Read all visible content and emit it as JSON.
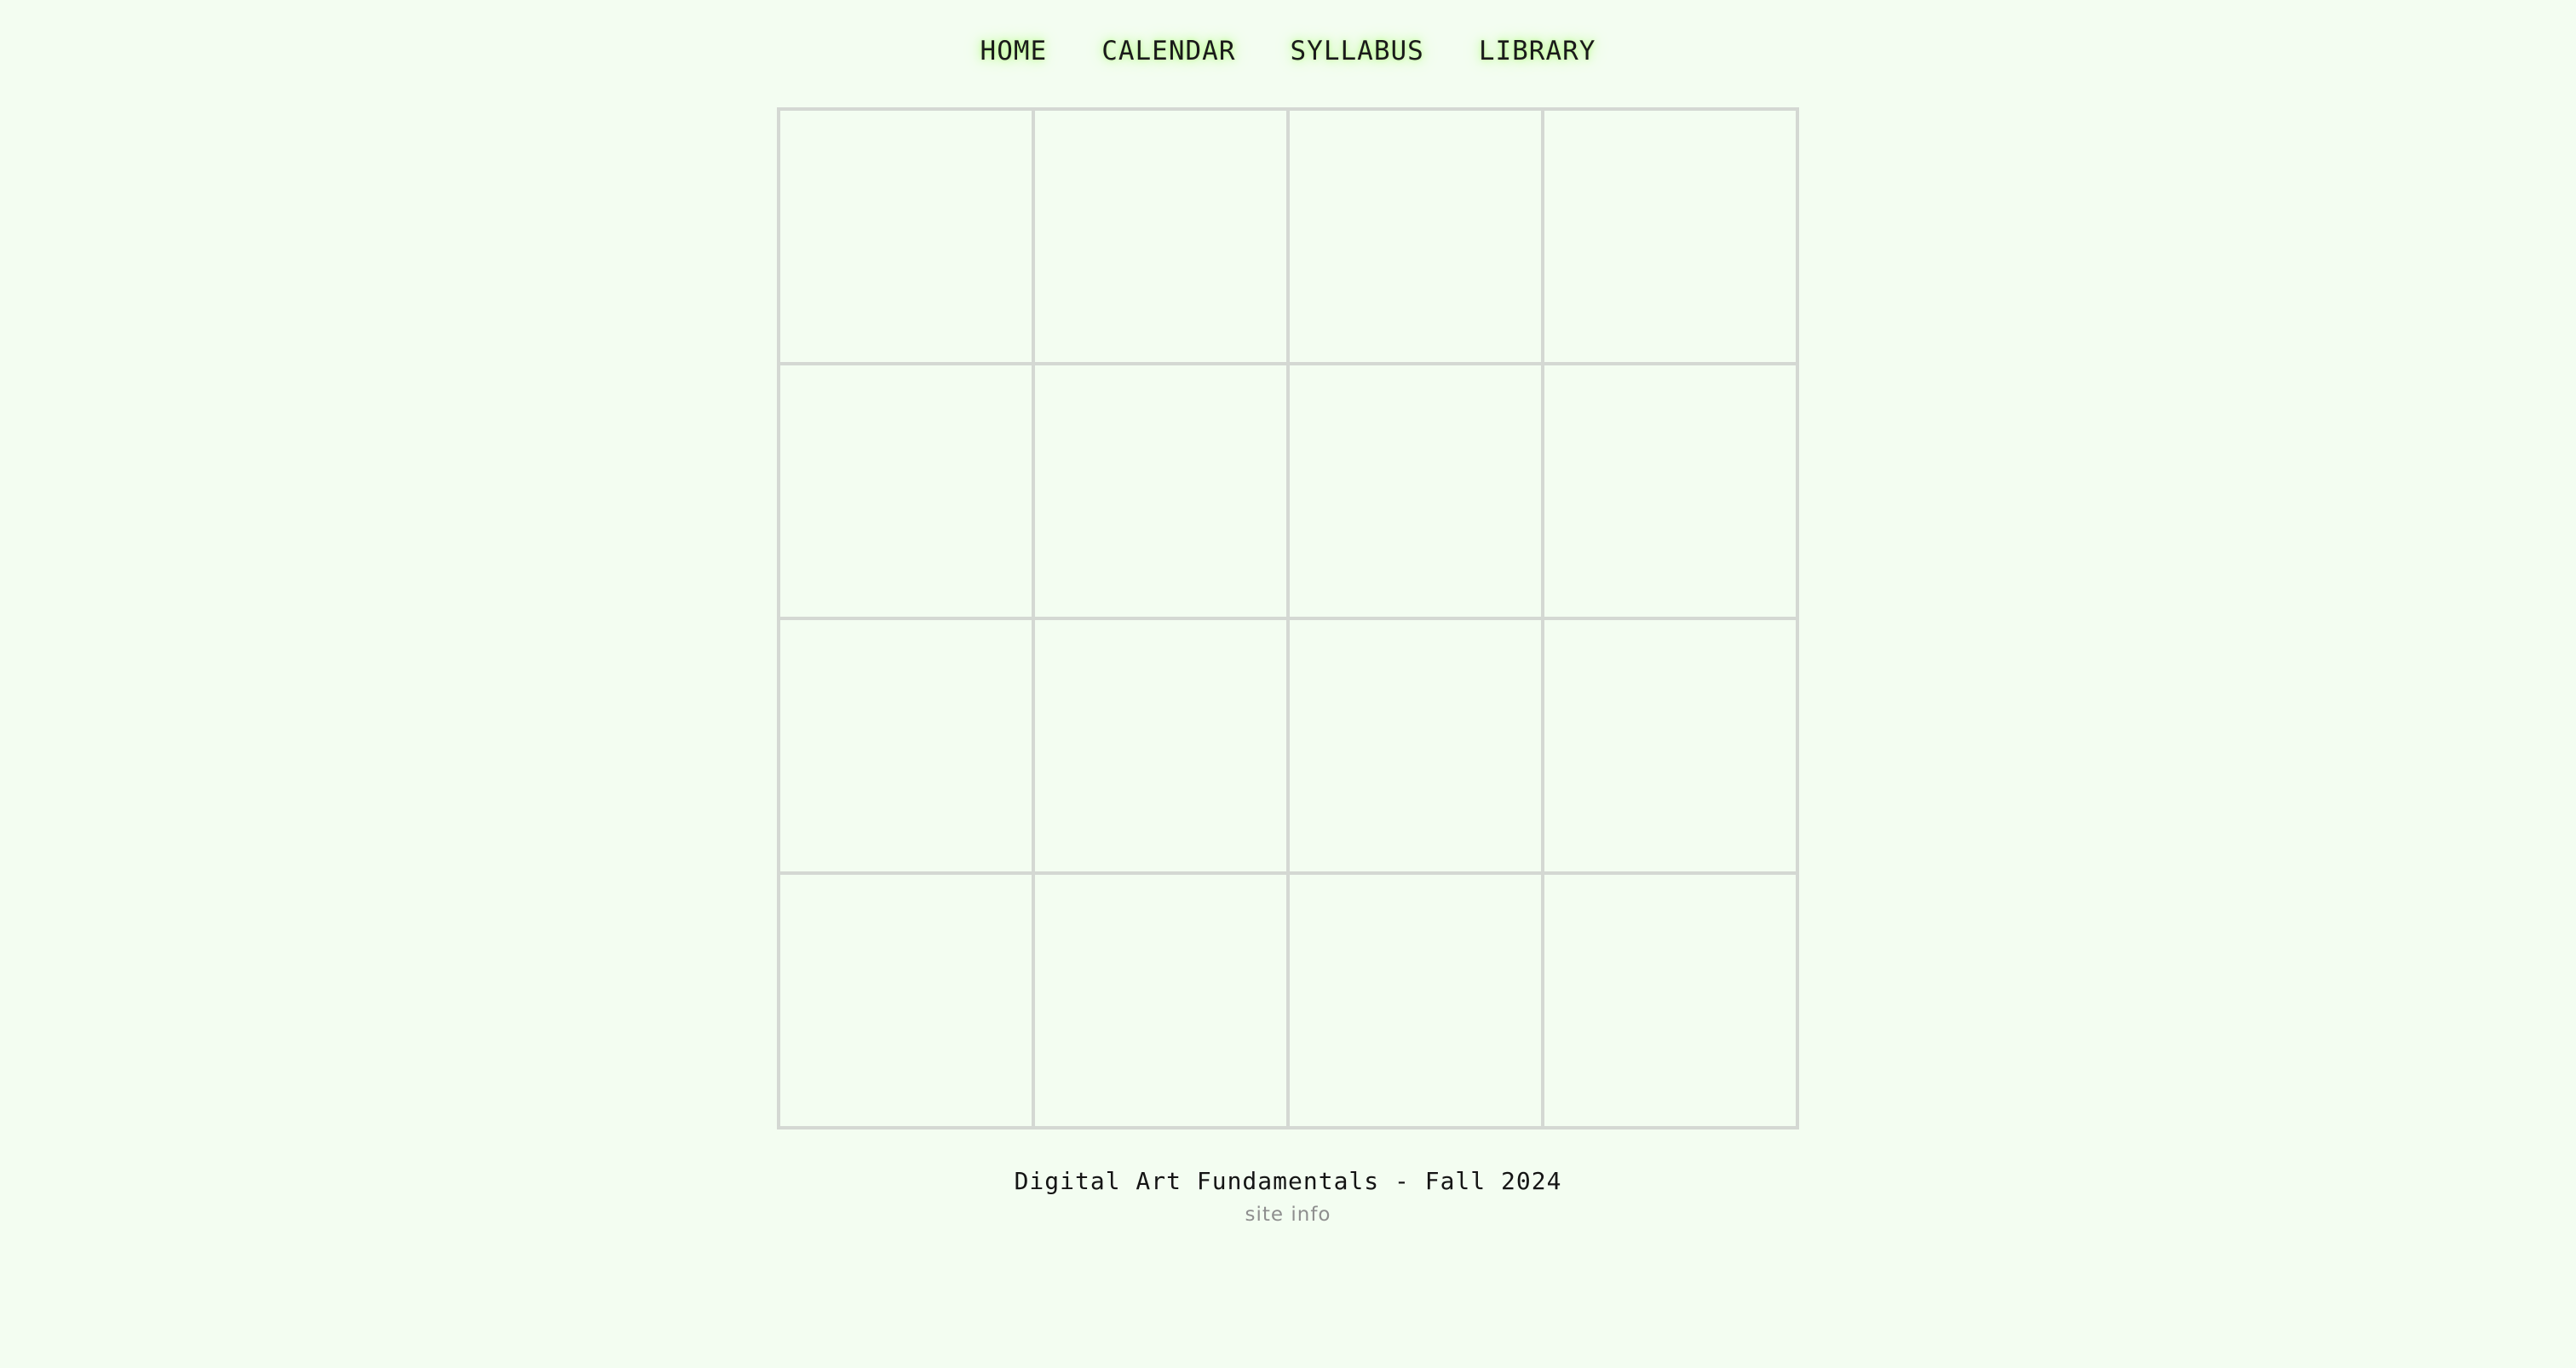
{
  "nav": {
    "items": [
      {
        "label": "HOME"
      },
      {
        "label": "CALENDAR"
      },
      {
        "label": "SYLLABUS"
      },
      {
        "label": "LIBRARY"
      }
    ]
  },
  "grid": {
    "rows": 4,
    "columns": 4,
    "cell_count": 16
  },
  "footer": {
    "title": "Digital Art Fundamentals - Fall 2024",
    "sub_link": "site info"
  },
  "colors": {
    "background": "#f3fdf1",
    "grid_border": "#d4d8d3",
    "nav_glow": "#b7ff8f",
    "footer_sub_text": "#8e8e8e"
  }
}
